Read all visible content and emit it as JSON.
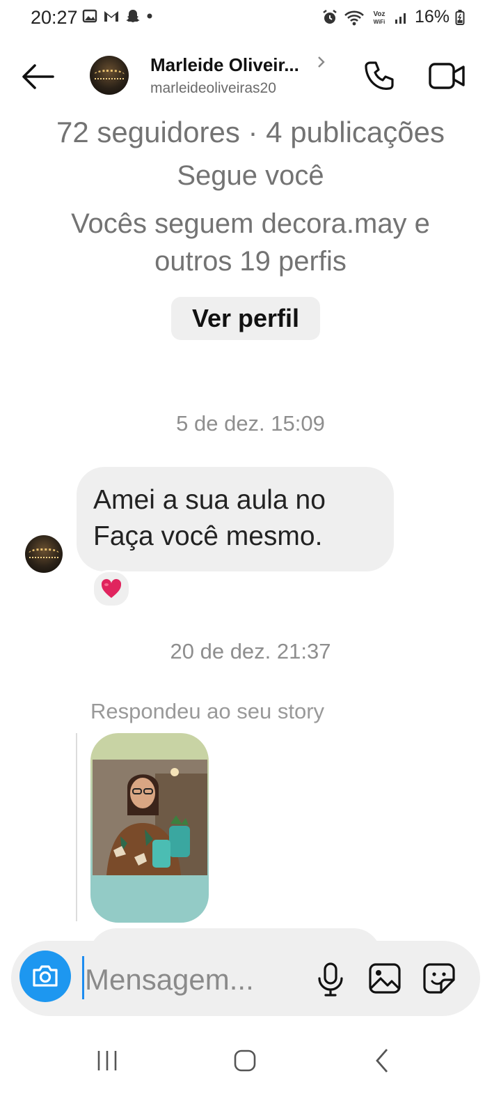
{
  "status_bar": {
    "time": "20:27",
    "battery": "16%",
    "network_label": "Voz WiFi"
  },
  "header": {
    "name": "Marleide Oliveir...",
    "username": "marleideoliveiras20"
  },
  "profile_info": {
    "stats": "72 seguidores · 4 publicações",
    "follows_you": "Segue você",
    "mutual_line1": "Vocês seguem decora.may e",
    "mutual_line2": "outros 19 perfis",
    "view_profile_label": "Ver perfil"
  },
  "messages": {
    "timestamp1": "5 de dez. 15:09",
    "message1": "Amei a sua aula no Faça você mesmo.",
    "reaction_emoji": "❤️",
    "timestamp2": "20 de dez. 21:37",
    "reply_label": "Respondeu ao seu story"
  },
  "composer": {
    "placeholder": "Mensagem..."
  },
  "colors": {
    "accent": "#1d97f0",
    "bubble": "#efefef",
    "muted_text": "#737373",
    "heart": "#e0245e"
  },
  "icons": [
    "back-arrow-icon",
    "chevron-right-icon",
    "phone-icon",
    "video-camera-icon",
    "camera-icon",
    "microphone-icon",
    "gallery-icon",
    "sticker-icon",
    "heart-icon",
    "nav-recent-icon",
    "nav-home-icon",
    "nav-back-icon"
  ]
}
